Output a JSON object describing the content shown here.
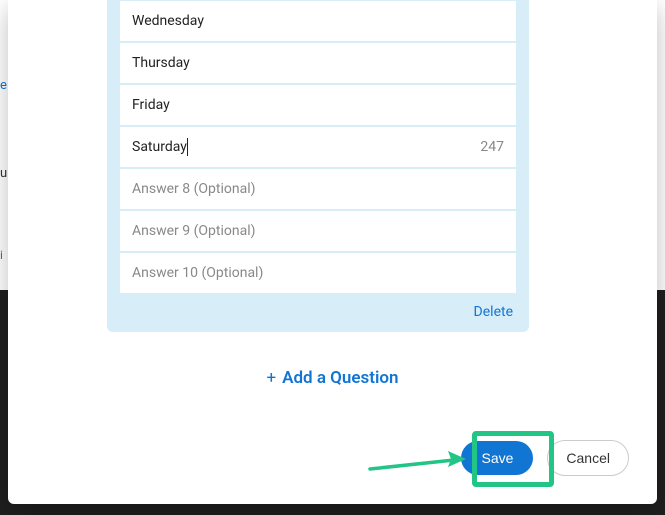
{
  "answers": {
    "a3": "Wednesday",
    "a4": "Thursday",
    "a5": "Friday",
    "a6": "Saturday",
    "char_count": "247",
    "a8": "Answer 8 (Optional)",
    "a9": "Answer 9 (Optional)",
    "a10": "Answer 10 (Optional)"
  },
  "actions": {
    "delete": "Delete",
    "add_question": "Add a Question",
    "save": "Save",
    "cancel": "Cancel"
  },
  "bg": {
    "t1": "e",
    "t2": "u",
    "t3": "i"
  }
}
